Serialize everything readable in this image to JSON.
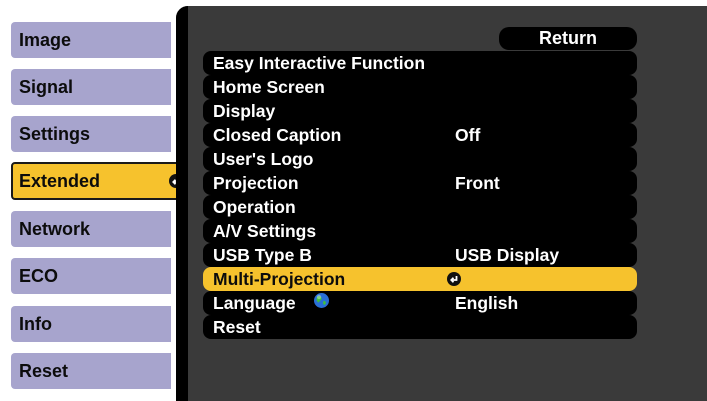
{
  "tabs": [
    {
      "label": "Image"
    },
    {
      "label": "Signal"
    },
    {
      "label": "Settings"
    },
    {
      "label": "Extended"
    },
    {
      "label": "Network"
    },
    {
      "label": "ECO"
    },
    {
      "label": "Info"
    },
    {
      "label": "Reset"
    }
  ],
  "selected_tab": "Extended",
  "return_label": "Return",
  "menu": [
    {
      "label": "Easy Interactive Function",
      "value": ""
    },
    {
      "label": "Home Screen",
      "value": ""
    },
    {
      "label": "Display",
      "value": ""
    },
    {
      "label": "Closed Caption",
      "value": "Off"
    },
    {
      "label": "User's Logo",
      "value": ""
    },
    {
      "label": "Projection",
      "value": "Front"
    },
    {
      "label": "Operation",
      "value": ""
    },
    {
      "label": "A/V Settings",
      "value": ""
    },
    {
      "label": "USB Type B",
      "value": "USB Display"
    },
    {
      "label": "Multi-Projection",
      "value": ""
    },
    {
      "label": "Language",
      "value": "English"
    },
    {
      "label": "Reset",
      "value": ""
    }
  ],
  "selected_menu_item": "Multi-Projection",
  "colors": {
    "tab_bg": "#a7a4cd",
    "highlight": "#f6c22d",
    "panel_bg": "#3a3a3a",
    "row_bg": "#000000"
  },
  "icons": {
    "enter": "enter-icon",
    "language": "globe-icon"
  }
}
